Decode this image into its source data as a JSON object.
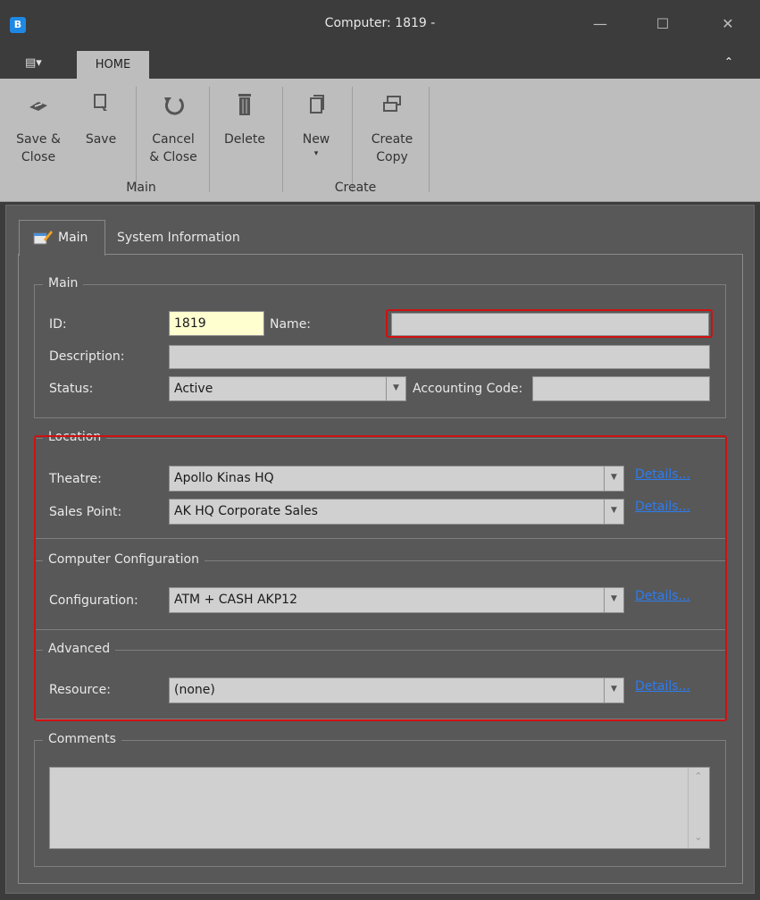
{
  "window": {
    "title": "Computer: 1819 -",
    "app_icon": "B",
    "minimize": "—",
    "maximize": "☐",
    "close": "✕"
  },
  "ribbon": {
    "app_menu": "▤▾",
    "tab_home": "HOME",
    "collapse": "⌃",
    "buttons": {
      "save_close": [
        "Save &",
        "Close"
      ],
      "save": "Save",
      "cancel_close": [
        "Cancel",
        "& Close"
      ],
      "delete": "Delete",
      "new": [
        "New",
        "▾"
      ],
      "create_copy": [
        "Create",
        "Copy"
      ]
    },
    "groups": {
      "main": "Main",
      "create": "Create"
    }
  },
  "tabs": {
    "main": "Main",
    "system_info": "System Information"
  },
  "main_group": {
    "legend": "Main",
    "id_label": "ID:",
    "id_value": "1819",
    "name_label": "Name:",
    "name_value": "",
    "description_label": "Description:",
    "description_value": "",
    "status_label": "Status:",
    "status_value": "Active",
    "accounting_code_label": "Accounting Code:",
    "accounting_code_value": ""
  },
  "location_group": {
    "legend": "Location",
    "theatre_label": "Theatre:",
    "theatre_value": "Apollo Kinas HQ",
    "sales_point_label": "Sales Point:",
    "sales_point_value": "AK HQ Corporate Sales",
    "details": "Details..."
  },
  "config_group": {
    "legend": "Computer Configuration",
    "configuration_label": "Configuration:",
    "configuration_value": "ATM + CASH AKP12",
    "details": "Details..."
  },
  "advanced_group": {
    "legend": "Advanced",
    "resource_label": "Resource:",
    "resource_value": "(none)",
    "details": "Details..."
  },
  "comments_group": {
    "legend": "Comments",
    "value": ""
  },
  "colors": {
    "highlight": "#d01010",
    "link": "#2d7cf0",
    "id_bg": "#ffffd0"
  }
}
